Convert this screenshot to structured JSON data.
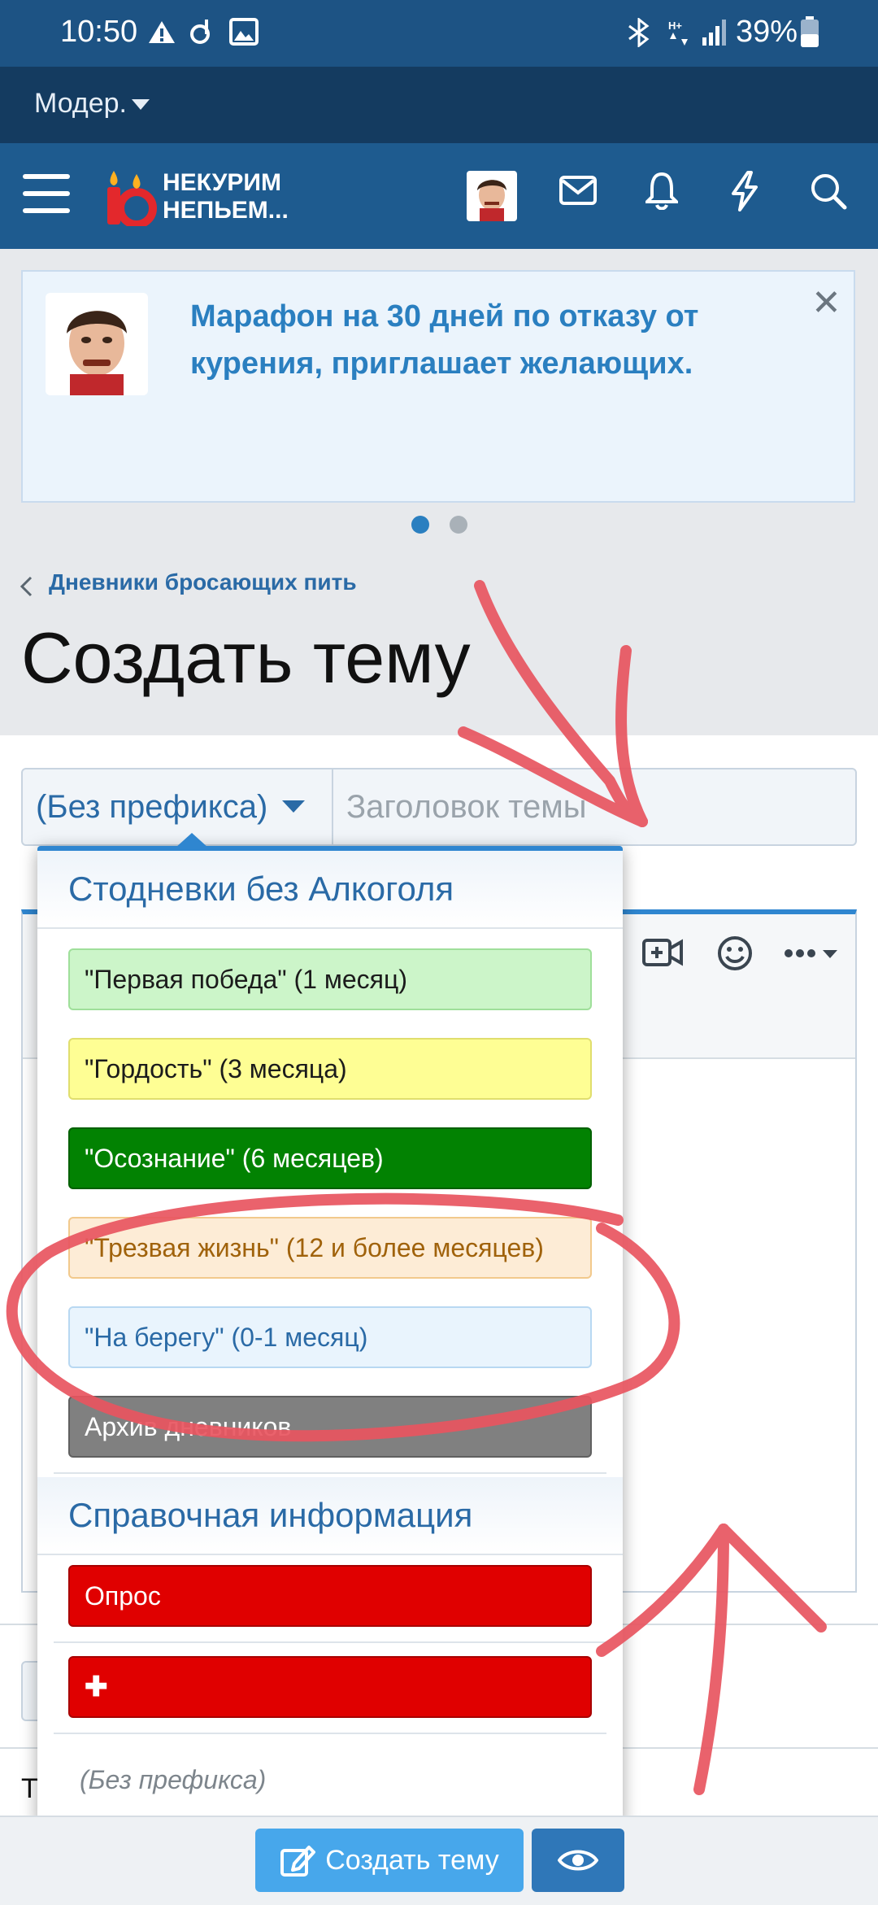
{
  "status_bar": {
    "time": "10:50",
    "battery": "39%"
  },
  "mod_bar": {
    "label": "Модер."
  },
  "header": {
    "logo_line1": "НЕКУРИМ",
    "logo_line2": "НЕПЬЕМ..."
  },
  "banner": {
    "text": "Марафон на 30 дней по отказу от курения, приглашает желающих.",
    "close": "✕"
  },
  "breadcrumb": {
    "label": "Дневники бросающих пить"
  },
  "page_title": "Создать тему",
  "form": {
    "prefix_value": "(Без префикса)",
    "title_placeholder": "Заголовок темы"
  },
  "prefix_menu": {
    "group1": "Стодневки без Алкоголя",
    "group1_items": [
      {
        "label": "\"Первая победа\" (1 месяц)",
        "bg": "#ccf5c9",
        "color": "#1b1b1b",
        "border": "#9fdf9a"
      },
      {
        "label": "\"Гордость\" (3 месяца)",
        "bg": "#fefe94",
        "color": "#1b1b1b",
        "border": "#e0de6e"
      },
      {
        "label": "\"Осознание\" (6 месяцев)",
        "bg": "#028202",
        "color": "#ffffff",
        "border": "#016001"
      },
      {
        "label": "\"Трезвая жизнь\" (12 и более месяцев)",
        "bg": "#fdecd6",
        "color": "#a0620b",
        "border": "#f2c98c"
      },
      {
        "label": "\"На берегу\" (0-1 месяц)",
        "bg": "#e9f4fd",
        "color": "#2a6aa6",
        "border": "#b8d8f2"
      },
      {
        "label": "Архив дневников",
        "bg": "#808080",
        "color": "#ffffff",
        "border": "#606060"
      }
    ],
    "group2": "Справочная информация",
    "group2_items": [
      {
        "label": "Опрос",
        "bg": "#e00000",
        "color": "#ffffff",
        "border": "#a80000"
      },
      {
        "label": "✚",
        "bg": "#e00000",
        "color": "#ffffff",
        "border": "#a80000"
      }
    ],
    "none_option": "(Без префикса)"
  },
  "bottom": {
    "create_label": "Создать тему",
    "partial_label": "Т"
  }
}
